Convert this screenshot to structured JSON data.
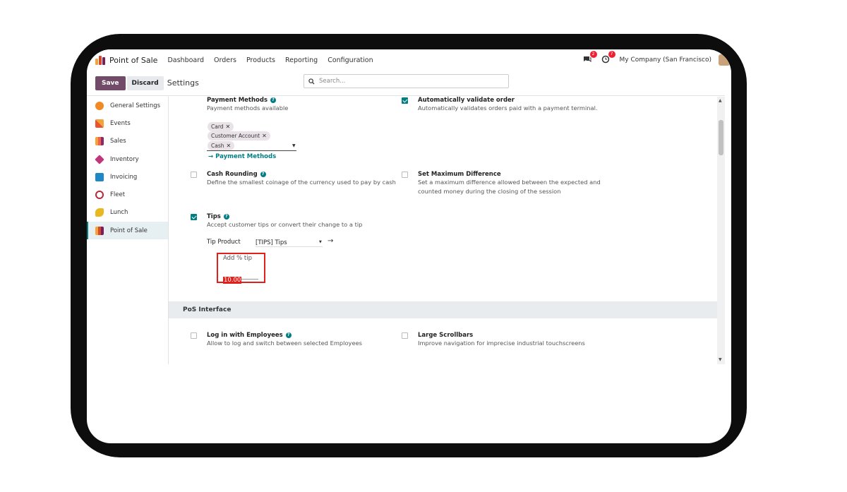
{
  "nav": {
    "app_title": "Point of Sale",
    "items": [
      "Dashboard",
      "Orders",
      "Products",
      "Reporting",
      "Configuration"
    ],
    "messages_badge": "2",
    "activities_badge": "7",
    "company": "My Company (San Francisco)"
  },
  "control": {
    "save_label": "Save",
    "discard_label": "Discard",
    "breadcrumb": "Settings",
    "search_placeholder": "Search..."
  },
  "sidebar": {
    "items": [
      {
        "label": "General Settings",
        "icon": "general-settings-icon",
        "color": "#f08a24"
      },
      {
        "label": "Events",
        "icon": "events-icon",
        "color": "#e8542f"
      },
      {
        "label": "Sales",
        "icon": "sales-icon",
        "color": "#f06050"
      },
      {
        "label": "Inventory",
        "icon": "inventory-icon",
        "color": "#c0367a"
      },
      {
        "label": "Invoicing",
        "icon": "invoicing-icon",
        "color": "#1e88c6"
      },
      {
        "label": "Fleet",
        "icon": "fleet-icon",
        "color": "#b82a3a"
      },
      {
        "label": "Lunch",
        "icon": "lunch-icon",
        "color": "#e8b820"
      },
      {
        "label": "Point of Sale",
        "icon": "point-of-sale-icon",
        "color": "#d14a2c"
      }
    ]
  },
  "payment_methods": {
    "title": "Payment Methods",
    "desc": "Payment methods available",
    "tags": [
      "Card",
      "Customer Account",
      "Cash"
    ],
    "link": "Payment Methods"
  },
  "auto_validate": {
    "title": "Automatically validate order",
    "desc": "Automatically validates orders paid with a payment terminal.",
    "checked": true
  },
  "cash_rounding": {
    "title": "Cash Rounding",
    "desc": "Define the smallest coinage of the currency used to pay by cash",
    "checked": false
  },
  "max_difference": {
    "title": "Set Maximum Difference",
    "desc_line1": "Set a maximum difference allowed between the expected and",
    "desc_line2": "counted money during the closing of the session",
    "checked": false
  },
  "tips": {
    "title": "Tips",
    "desc": "Accept customer tips or convert their change to a tip",
    "checked": true,
    "tip_product_label": "Tip Product",
    "tip_product_value": "[TIPS] Tips",
    "add_tip_label": "Add % tip",
    "add_tip_value": "10.00",
    "highlight_color": "#e0201a"
  },
  "section": {
    "title": "PoS Interface"
  },
  "login_employees": {
    "title": "Log in with Employees",
    "desc": "Allow to log and switch between selected Employees",
    "checked": false
  },
  "large_scrollbars": {
    "title": "Large Scrollbars",
    "desc": "Improve navigation for imprecise industrial touchscreens",
    "checked": false
  },
  "colors": {
    "primary": "#714b67",
    "teal": "#017e84"
  }
}
